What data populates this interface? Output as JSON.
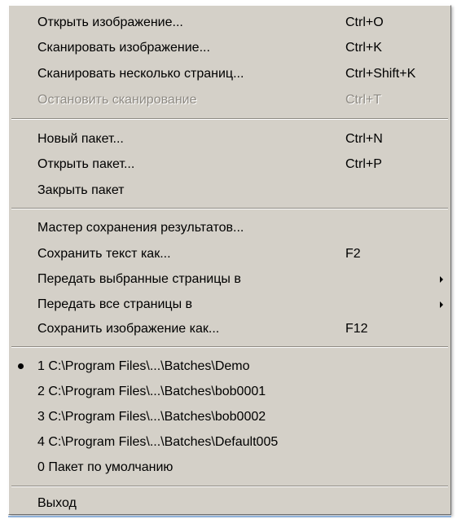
{
  "menu": {
    "groups": [
      [
        {
          "label": "Открыть изображение...",
          "shortcut": "Ctrl+O"
        },
        {
          "label": "Сканировать изображение...",
          "shortcut": "Ctrl+K"
        },
        {
          "label": "Сканировать несколько страниц...",
          "shortcut": "Ctrl+Shift+K"
        },
        {
          "label": "Остановить сканирование",
          "shortcut": "Ctrl+T",
          "disabled": true
        }
      ],
      [
        {
          "label": "Новый пакет...",
          "shortcut": "Ctrl+N"
        },
        {
          "label": "Открыть пакет...",
          "shortcut": "Ctrl+P"
        },
        {
          "label": "Закрыть пакет",
          "shortcut": ""
        }
      ],
      [
        {
          "label": "Мастер сохранения результатов...",
          "shortcut": ""
        },
        {
          "label": "Сохранить текст как...",
          "shortcut": "F2"
        },
        {
          "label": "Передать выбранные страницы в",
          "shortcut": "",
          "submenu": true
        },
        {
          "label": "Передать все страницы в",
          "shortcut": "",
          "submenu": true
        },
        {
          "label": "Сохранить изображение как...",
          "shortcut": "F12"
        }
      ],
      [
        {
          "label": "1 C:\\Program Files\\...\\Batches\\Demo",
          "checked": true
        },
        {
          "label": "2 C:\\Program Files\\...\\Batches\\bob0001"
        },
        {
          "label": "3 C:\\Program Files\\...\\Batches\\bob0002"
        },
        {
          "label": "4 C:\\Program Files\\...\\Batches\\Default005"
        },
        {
          "label": "0 Пакет по умолчанию"
        }
      ],
      [
        {
          "label": "Выход",
          "shortcut": ""
        }
      ]
    ]
  }
}
